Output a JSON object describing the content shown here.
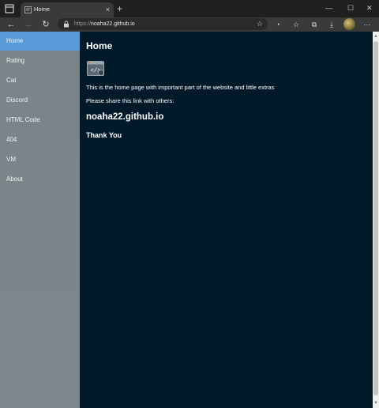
{
  "browser": {
    "tab": {
      "title": "Home",
      "close": "×"
    },
    "new_tab": "+",
    "window": {
      "minimize": "—",
      "maximize": "☐",
      "close": "✕"
    },
    "nav": {
      "back": "←",
      "forward": "→",
      "refresh": "↻"
    },
    "address": {
      "scheme": "https://",
      "host": "noaha22.github.io"
    },
    "icons": [
      "favorites-add-icon",
      "refresh-shield-icon",
      "favorites-icon",
      "collections-icon",
      "download-icon",
      "profile-icon",
      "more-icon"
    ]
  },
  "sidebar": {
    "items": [
      {
        "label": "Home",
        "active": true
      },
      {
        "label": "Rating",
        "active": false
      },
      {
        "label": "Cat",
        "active": false
      },
      {
        "label": "Discord",
        "active": false
      },
      {
        "label": "HTML Code",
        "active": false
      },
      {
        "label": "404",
        "active": false
      },
      {
        "label": "VM",
        "active": false
      },
      {
        "label": "About",
        "active": false
      }
    ]
  },
  "main": {
    "title": "Home",
    "intro": "This is the home page with important part of the website and little extras",
    "share_prompt": "Please share this link with others:",
    "link": "noaha22.github.io",
    "thanks": "Thank You"
  },
  "colors": {
    "sidebar_bg": "#7a8489",
    "active_item": "#5b9ad8",
    "content_bg": "#011a2a",
    "browser_chrome": "#202020"
  }
}
